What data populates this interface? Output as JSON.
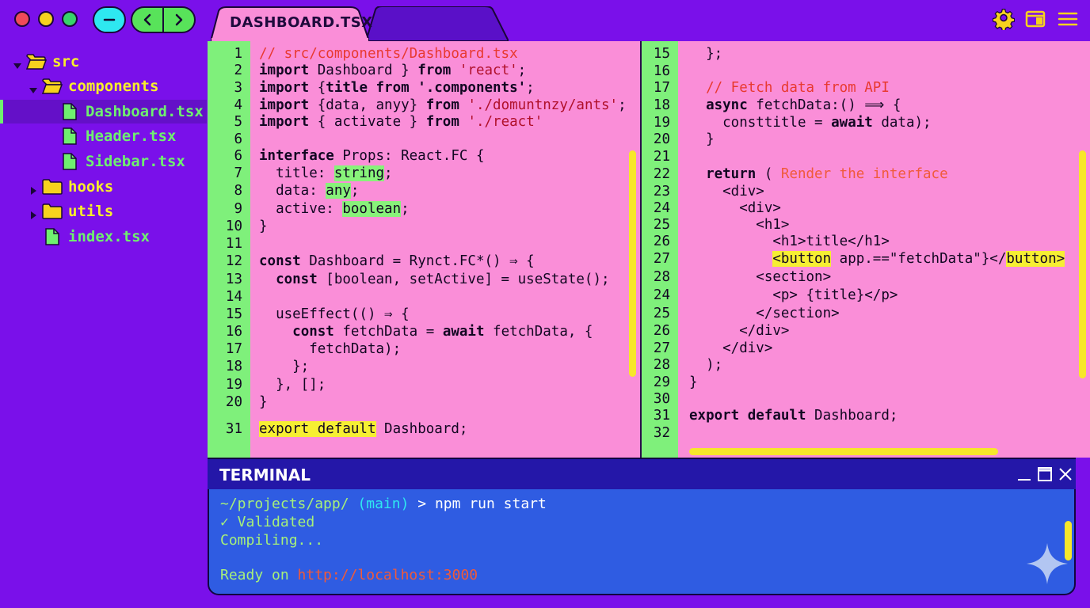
{
  "tabs": [
    {
      "label": "DASHBOARD.TSX",
      "active": true
    },
    {
      "label": "",
      "active": false
    }
  ],
  "sidebar": {
    "items": [
      {
        "label": "src",
        "type": "folder",
        "depth": 0,
        "expanded": true
      },
      {
        "label": "components",
        "type": "folder",
        "depth": 1,
        "expanded": true
      },
      {
        "label": "Dashboard.tsx",
        "type": "file",
        "depth": 2,
        "selected": true
      },
      {
        "label": "Header.tsx",
        "type": "file",
        "depth": 2
      },
      {
        "label": "Sidebar.tsx",
        "type": "file",
        "depth": 2
      },
      {
        "label": "hooks",
        "type": "folder",
        "depth": 1,
        "expanded": false
      },
      {
        "label": "utils",
        "type": "folder",
        "depth": 1,
        "expanded": false
      },
      {
        "label": "index.tsx",
        "type": "file",
        "depth": 1
      }
    ]
  },
  "editor_left": {
    "lines": [
      {
        "n": "1",
        "parts": [
          {
            "t": "// src/components/Dashboard.tsx",
            "c": "comment"
          }
        ]
      },
      {
        "n": "2",
        "parts": [
          {
            "t": "import",
            "c": "kw"
          },
          {
            "t": " Dashboard } "
          },
          {
            "t": "from",
            "c": "kw"
          },
          {
            "t": " "
          },
          {
            "t": "'react'",
            "c": "str"
          },
          {
            "t": ";"
          }
        ]
      },
      {
        "n": "3",
        "parts": [
          {
            "t": "import",
            "c": "kw"
          },
          {
            "t": " {"
          },
          {
            "t": "title from",
            "c": "kw"
          },
          {
            "t": " "
          },
          {
            "t": "'.components'",
            "c": "kw"
          },
          {
            "t": ";"
          }
        ]
      },
      {
        "n": "4",
        "parts": [
          {
            "t": "import",
            "c": "kw"
          },
          {
            "t": " {data, anyy} "
          },
          {
            "t": "from",
            "c": "kw"
          },
          {
            "t": " "
          },
          {
            "t": "'./domuntnzy/ants'",
            "c": "str"
          },
          {
            "t": ";"
          }
        ]
      },
      {
        "n": "5",
        "parts": [
          {
            "t": "import",
            "c": "kw"
          },
          {
            "t": " { activate } "
          },
          {
            "t": "from",
            "c": "kw"
          },
          {
            "t": " "
          },
          {
            "t": "'./react'",
            "c": "str"
          }
        ]
      },
      {
        "n": "6",
        "parts": []
      },
      {
        "n": "6",
        "parts": [
          {
            "t": "interface",
            "c": "kw"
          },
          {
            "t": " Props: React.FC {"
          }
        ]
      },
      {
        "n": "7",
        "parts": [
          {
            "t": "  title: "
          },
          {
            "t": "string",
            "c": "hl-g"
          },
          {
            "t": ";"
          }
        ]
      },
      {
        "n": "8",
        "parts": [
          {
            "t": "  data: "
          },
          {
            "t": "any",
            "c": "hl-g"
          },
          {
            "t": ";"
          }
        ]
      },
      {
        "n": "9",
        "parts": [
          {
            "t": "  active: "
          },
          {
            "t": "boolean",
            "c": "hl-g"
          },
          {
            "t": ";"
          }
        ]
      },
      {
        "n": "10",
        "parts": [
          {
            "t": "}"
          }
        ]
      },
      {
        "n": "11",
        "parts": []
      },
      {
        "n": "12",
        "parts": [
          {
            "t": "const",
            "c": "kw"
          },
          {
            "t": " Dashboard = Rynct.FC*() ⇒ {"
          }
        ]
      },
      {
        "n": "13",
        "parts": [
          {
            "t": "  "
          },
          {
            "t": "const",
            "c": "kw"
          },
          {
            "t": " [boolean, setActive] = useState();"
          }
        ]
      },
      {
        "n": "14",
        "parts": []
      },
      {
        "n": "15",
        "parts": [
          {
            "t": "  useEffect(() ⇒ {"
          }
        ]
      },
      {
        "n": "16",
        "parts": [
          {
            "t": "    "
          },
          {
            "t": "const",
            "c": "kw"
          },
          {
            "t": " fetchData = "
          },
          {
            "t": "await",
            "c": "kw"
          },
          {
            "t": " fetchData, {"
          }
        ]
      },
      {
        "n": "17",
        "parts": [
          {
            "t": "      fetchData);"
          }
        ]
      },
      {
        "n": "18",
        "parts": [
          {
            "t": "    };"
          }
        ]
      },
      {
        "n": "19",
        "parts": [
          {
            "t": "  }, [];"
          }
        ]
      },
      {
        "n": "20",
        "parts": [
          {
            "t": "}"
          }
        ]
      },
      {
        "n": "31",
        "parts": [
          {
            "t": "export default",
            "c": "hl-y"
          },
          {
            "t": " Dashboard;"
          }
        ]
      }
    ]
  },
  "editor_right": {
    "lines": [
      {
        "n": "15",
        "parts": [
          {
            "t": "  };"
          }
        ]
      },
      {
        "n": "16",
        "parts": []
      },
      {
        "n": "17",
        "parts": [
          {
            "t": "  // Fetch data from API",
            "c": "comment"
          }
        ]
      },
      {
        "n": "18",
        "parts": [
          {
            "t": "  "
          },
          {
            "t": "async",
            "c": "kw"
          },
          {
            "t": " fetchData:() ⟹ {"
          }
        ]
      },
      {
        "n": "19",
        "parts": [
          {
            "t": "    consttitle = "
          },
          {
            "t": "await",
            "c": "kw"
          },
          {
            "t": " data);"
          }
        ]
      },
      {
        "n": "20",
        "parts": [
          {
            "t": "  }"
          }
        ]
      },
      {
        "n": "21",
        "parts": []
      },
      {
        "n": "22",
        "parts": [
          {
            "t": "  "
          },
          {
            "t": "return",
            "c": "kw"
          },
          {
            "t": " ( "
          },
          {
            "t": "Render the interface",
            "c": "orange"
          }
        ]
      },
      {
        "n": "23",
        "parts": [
          {
            "t": "    <div>"
          }
        ]
      },
      {
        "n": "24",
        "parts": [
          {
            "t": "      <div>"
          }
        ]
      },
      {
        "n": "25",
        "parts": [
          {
            "t": "        <h1>"
          }
        ]
      },
      {
        "n": "26",
        "parts": [
          {
            "t": "          <h1>title</h1>"
          }
        ]
      },
      {
        "n": "27",
        "parts": [
          {
            "t": "          "
          },
          {
            "t": "<button",
            "c": "hl-y"
          },
          {
            "t": " app.==\"fetchData\"}</"
          },
          {
            "t": "button>",
            "c": "hl-y"
          }
        ]
      },
      {
        "n": "28",
        "parts": [
          {
            "t": "        <section>"
          }
        ]
      },
      {
        "n": "24",
        "parts": [
          {
            "t": "          <p> {title}</p>"
          }
        ]
      },
      {
        "n": "25",
        "parts": [
          {
            "t": "        </section>"
          }
        ]
      },
      {
        "n": "26",
        "parts": [
          {
            "t": "      </div>"
          }
        ]
      },
      {
        "n": "27",
        "parts": [
          {
            "t": "    </div>"
          }
        ]
      },
      {
        "n": "28",
        "parts": [
          {
            "t": "  );"
          }
        ]
      },
      {
        "n": "29",
        "parts": [
          {
            "t": "}"
          }
        ]
      },
      {
        "n": "30",
        "parts": []
      },
      {
        "n": "31",
        "parts": [
          {
            "t": "export default",
            "c": "kw"
          },
          {
            "t": " Dashboard;"
          }
        ]
      },
      {
        "n": "32",
        "parts": []
      }
    ]
  },
  "terminal": {
    "title": "TERMINAL",
    "prompt_path": "~/projects/app/",
    "prompt_branch": "(main)",
    "prompt_symbol": ">",
    "command": "npm run start",
    "validated": "✓ Validated",
    "compiling": "Compiling...",
    "ready_prefix": "Ready on ",
    "ready_url": "http://localhost:3000"
  },
  "colors": {
    "background": "#7a10ea",
    "editor_bg": "#fa8ed8",
    "gutter": "#7ff07b",
    "terminal_header": "#2417a8",
    "terminal_body": "#2f5ce2",
    "accent_yellow": "#f7e72a"
  },
  "icons": {
    "window_controls": [
      "close-dot",
      "minimize-dot",
      "maximize-dot"
    ],
    "toolbar_right": [
      "gear-icon",
      "layout-panel-icon",
      "menu-icon"
    ]
  }
}
